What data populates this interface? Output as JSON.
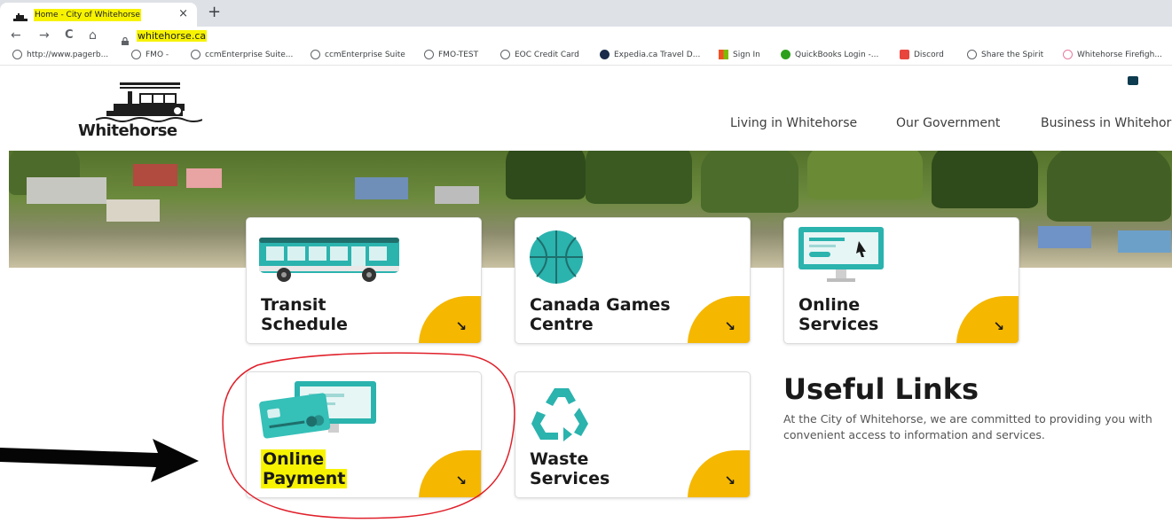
{
  "browser": {
    "tab_title": "Home - City of Whitehorse",
    "tab_close": "×",
    "new_tab": "+",
    "back": "←",
    "forward": "→",
    "reload": "C",
    "home": "⌂",
    "url": "whitehorse.ca",
    "bookmarks": [
      "http://www.pagerb...",
      "FMO -",
      "ccmEnterprise Suite...",
      "ccmEnterprise Suite",
      "FMO-TEST",
      "EOC Credit Card",
      "Expedia.ca Travel D...",
      "Sign In",
      "QuickBooks Login -...",
      "Discord",
      "Share the Spirit",
      "Whitehorse Firefigh..."
    ]
  },
  "site": {
    "logo_text": "Whitehorse",
    "nav": [
      "Living in Whitehorse",
      "Our Government",
      "Business in Whitehorse"
    ]
  },
  "cards": [
    {
      "line1": "Transit",
      "line2": "Schedule",
      "icon": "bus-icon"
    },
    {
      "line1": "Canada Games",
      "line2": "Centre",
      "icon": "basketball-icon"
    },
    {
      "line1": "Online",
      "line2": "Services",
      "icon": "computer-icon"
    },
    {
      "line1": "Online",
      "line2": "Payment",
      "icon": "credit-card-icon"
    },
    {
      "line1": "Waste",
      "line2": "Services",
      "icon": "recycle-icon"
    }
  ],
  "card_arrow": "↘",
  "useful_links": {
    "title": "Useful Links",
    "body": "At the City of Whitehorse, we are committed to providing you with convenient access to information and services."
  },
  "colors": {
    "accent_yellow": "#f5b700",
    "highlight": "#f7f300",
    "teal": "#2bb3ae",
    "annotation_red": "#e0202a"
  }
}
